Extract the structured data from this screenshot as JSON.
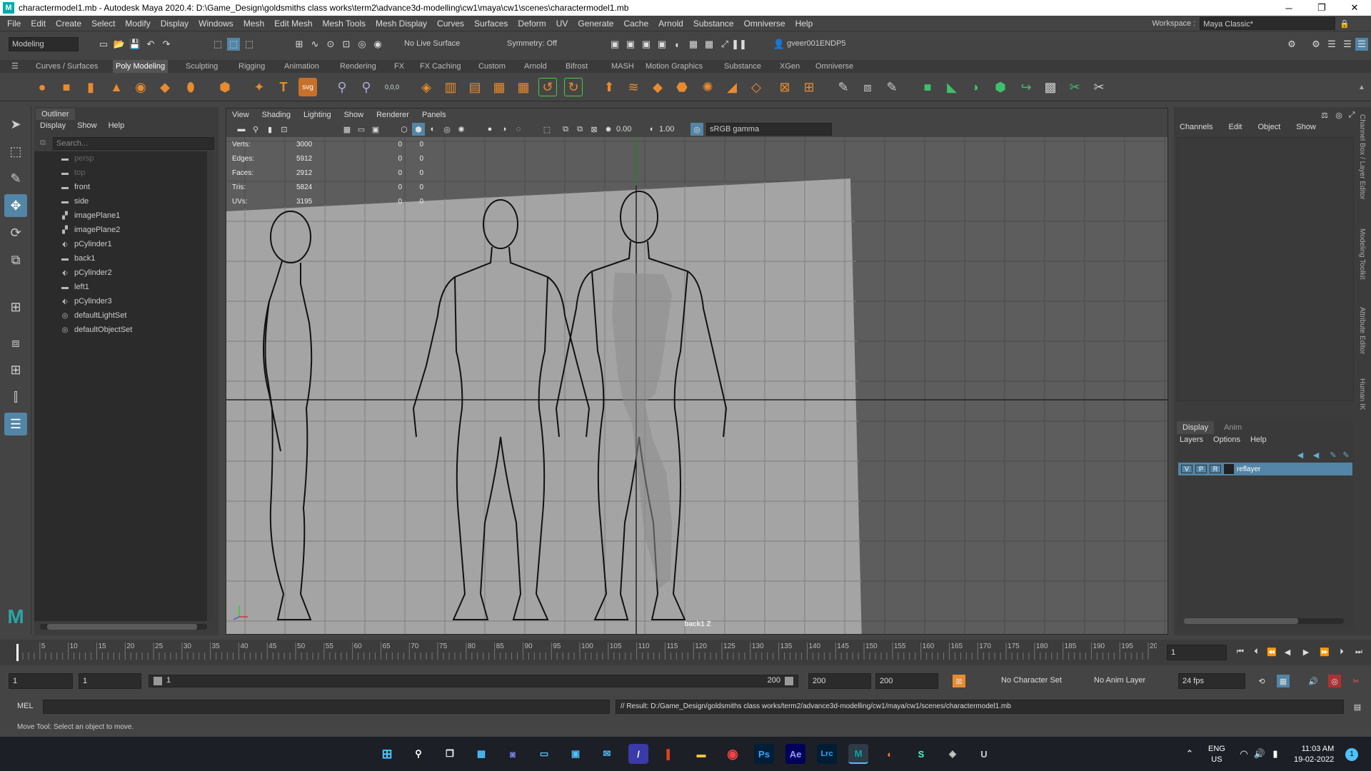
{
  "window": {
    "title": "charactermodel1.mb - Autodesk Maya 2020.4: D:\\Game_Design\\goldsmiths class works\\term2\\advance3d-modelling\\cw1\\maya\\cw1\\scenes\\charactermodel1.mb",
    "logo": "M",
    "minimize": "─",
    "maximize": "❐",
    "close": "✕"
  },
  "menubar": {
    "items": [
      "File",
      "Edit",
      "Create",
      "Select",
      "Modify",
      "Display",
      "Windows",
      "Mesh",
      "Edit Mesh",
      "Mesh Tools",
      "Mesh Display",
      "Curves",
      "Surfaces",
      "Deform",
      "UV",
      "Generate",
      "Cache",
      "Arnold",
      "Substance",
      "Omniverse",
      "Help"
    ],
    "workspace_label": "Workspace :",
    "workspace_value": "Maya Classic*"
  },
  "statusline": {
    "mode": "Modeling",
    "live_surface": "No Live Surface",
    "symmetry": "Symmetry: Off",
    "user": "gveer001ENDP5"
  },
  "shelf": {
    "tabs": [
      "Curves / Surfaces",
      "Poly Modeling",
      "Sculpting",
      "Rigging",
      "Animation",
      "Rendering",
      "FX",
      "FX Caching",
      "Custom",
      "Arnold",
      "Bifrost",
      "MASH",
      "Motion Graphics",
      "Substance",
      "XGen",
      "Omniverse"
    ],
    "active_tab": "Poly Modeling",
    "svg_label": "svg",
    "text_label": "T",
    "num_label": "0,0,0"
  },
  "outliner": {
    "title": "Outliner",
    "menu": [
      "Display",
      "Show",
      "Help"
    ],
    "search_placeholder": "Search...",
    "items": [
      {
        "label": "persp",
        "icon": "camera-icon",
        "dim": true
      },
      {
        "label": "top",
        "icon": "camera-icon",
        "dim": true
      },
      {
        "label": "front",
        "icon": "camera-icon",
        "dim": false
      },
      {
        "label": "side",
        "icon": "camera-icon",
        "dim": false
      },
      {
        "label": "imagePlane1",
        "icon": "image-plane-icon",
        "dim": false
      },
      {
        "label": "imagePlane2",
        "icon": "image-plane-icon",
        "dim": false
      },
      {
        "label": "pCylinder1",
        "icon": "mesh-icon",
        "dim": false
      },
      {
        "label": "back1",
        "icon": "camera-icon",
        "dim": false
      },
      {
        "label": "pCylinder2",
        "icon": "mesh-icon",
        "dim": false
      },
      {
        "label": "left1",
        "icon": "camera-icon",
        "dim": false
      },
      {
        "label": "pCylinder3",
        "icon": "mesh-icon",
        "dim": false
      },
      {
        "label": "defaultLightSet",
        "icon": "set-icon",
        "dim": false
      },
      {
        "label": "defaultObjectSet",
        "icon": "set-icon",
        "dim": false
      }
    ]
  },
  "viewport": {
    "menu": [
      "View",
      "Shading",
      "Lighting",
      "Show",
      "Renderer",
      "Panels"
    ],
    "field_a": "0.00",
    "field_b": "1.00",
    "color_space": "sRGB gamma",
    "hud": [
      {
        "label": "Verts:",
        "a": "3000",
        "b": "0",
        "c": "0"
      },
      {
        "label": "Edges:",
        "a": "5912",
        "b": "0",
        "c": "0"
      },
      {
        "label": "Faces:",
        "a": "2912",
        "b": "0",
        "c": "0"
      },
      {
        "label": "Tris:",
        "a": "5824",
        "b": "0",
        "c": "0"
      },
      {
        "label": "UVs:",
        "a": "3195",
        "b": "0",
        "c": "0"
      }
    ],
    "camera_label": "back1 Z"
  },
  "channelbox": {
    "menu": [
      "Channels",
      "Edit",
      "Object",
      "Show"
    ],
    "layer_tabs": [
      "Display",
      "Anim"
    ],
    "layer_menu": [
      "Layers",
      "Options",
      "Help"
    ],
    "layer": {
      "v": "V",
      "p": "P",
      "r": "R",
      "name": "reflayer"
    }
  },
  "sidetabs": [
    "Channel Box / Layer Editor",
    "Modeling Toolkit",
    "Attribute Editor",
    "Human IK"
  ],
  "timeline": {
    "ticks": [
      "5",
      "10",
      "15",
      "20",
      "25",
      "30",
      "35",
      "40",
      "45",
      "50",
      "55",
      "60",
      "65",
      "70",
      "75",
      "80",
      "85",
      "90",
      "95",
      "100",
      "105",
      "110",
      "115",
      "120",
      "125",
      "130",
      "135",
      "140",
      "145",
      "150",
      "155",
      "160",
      "165",
      "170",
      "175",
      "180",
      "185",
      "190",
      "195",
      "200"
    ],
    "current_frame": "1",
    "start": "1",
    "playback_start": "1",
    "slider_start": "1",
    "slider_end": "200",
    "playback_end": "200",
    "end": "200",
    "character_set": "No Character Set",
    "anim_layer": "No Anim Layer",
    "fps": "24 fps"
  },
  "cmdline": {
    "label": "MEL",
    "result": "// Result: D:/Game_Design/goldsmiths class works/term2/advance3d-modelling/cw1/maya/cw1/scenes/charactermodel1.mb"
  },
  "helpline": "Move Tool: Select an object to move.",
  "taskbar": {
    "lang": "ENG",
    "region": "US",
    "time": "11:03 AM",
    "date": "19-02-2022",
    "badge": "1",
    "apps": [
      "Ps",
      "Ae",
      "Lrc"
    ]
  }
}
